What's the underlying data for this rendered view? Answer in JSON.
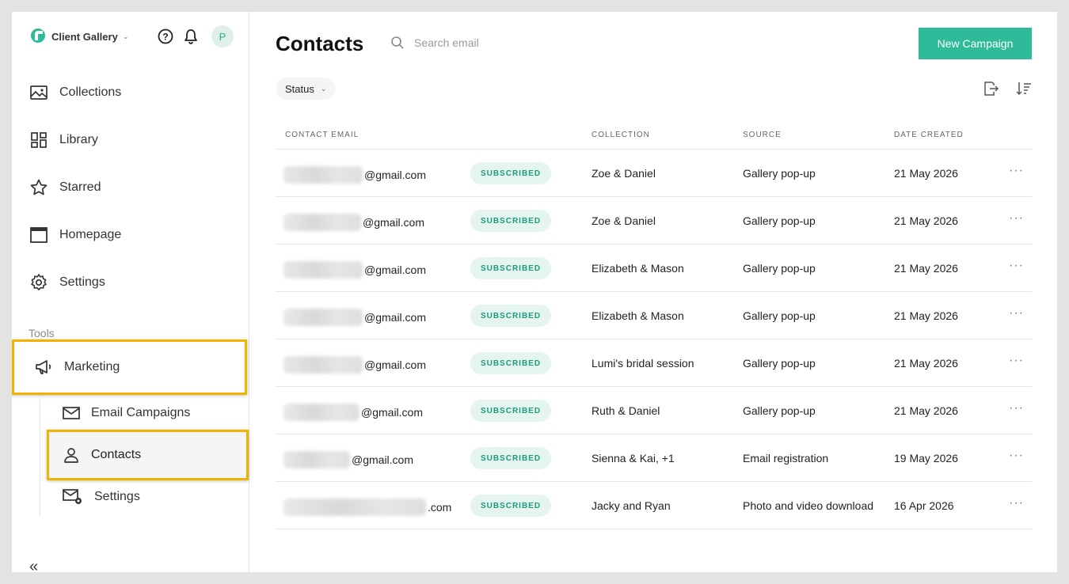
{
  "brand": {
    "name": "Client Gallery",
    "avatar_letter": "P"
  },
  "nav": {
    "items": [
      {
        "label": "Collections",
        "icon": "image-icon"
      },
      {
        "label": "Library",
        "icon": "grid-icon"
      },
      {
        "label": "Starred",
        "icon": "star-icon"
      },
      {
        "label": "Homepage",
        "icon": "browser-icon"
      },
      {
        "label": "Settings",
        "icon": "gear-icon"
      }
    ],
    "tools_label": "Tools",
    "marketing": "Marketing",
    "sub": {
      "email_campaigns": "Email Campaigns",
      "contacts": "Contacts",
      "settings": "Settings"
    },
    "highlight_color": "#f0b400"
  },
  "header": {
    "title": "Contacts",
    "search_placeholder": "Search email",
    "new_campaign": "New Campaign",
    "status_filter": "Status",
    "accent": "#2fba9a"
  },
  "table": {
    "columns": [
      "CONTACT EMAIL",
      "COLLECTION",
      "SOURCE",
      "DATE CREATED"
    ],
    "rows": [
      {
        "email_suffix": "@gmail.com",
        "status": "SUBSCRIBED",
        "collection": "Zoe & Daniel",
        "source": "Gallery pop-up",
        "date": "21 May 2026"
      },
      {
        "email_suffix": "@gmail.com",
        "status": "SUBSCRIBED",
        "collection": "Zoe & Daniel",
        "source": "Gallery pop-up",
        "date": "21 May 2026"
      },
      {
        "email_suffix": "@gmail.com",
        "status": "SUBSCRIBED",
        "collection": "Elizabeth & Mason",
        "source": "Gallery pop-up",
        "date": "21 May 2026"
      },
      {
        "email_suffix": "@gmail.com",
        "status": "SUBSCRIBED",
        "collection": "Elizabeth & Mason",
        "source": "Gallery pop-up",
        "date": "21 May 2026"
      },
      {
        "email_suffix": "@gmail.com",
        "status": "SUBSCRIBED",
        "collection": "Lumi's bridal session",
        "source": "Gallery pop-up",
        "date": "21 May 2026"
      },
      {
        "email_suffix": "@gmail.com",
        "status": "SUBSCRIBED",
        "collection": "Ruth & Daniel",
        "source": "Gallery pop-up",
        "date": "21 May 2026"
      },
      {
        "email_suffix": "@gmail.com",
        "status": "SUBSCRIBED",
        "collection": "Sienna & Kai, +1",
        "source": "Email registration",
        "date": "19 May 2026"
      },
      {
        "email_suffix": ".com",
        "status": "SUBSCRIBED",
        "collection": "Jacky and Ryan",
        "source": "Photo and video download",
        "date": "16 Apr 2026"
      }
    ],
    "more_glyph": "···"
  }
}
